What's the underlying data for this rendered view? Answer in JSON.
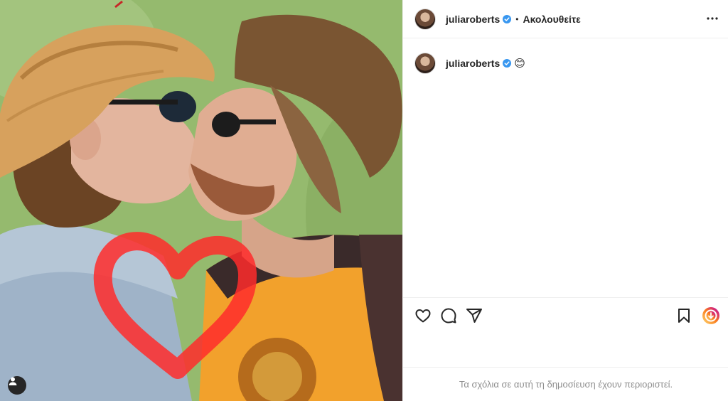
{
  "post": {
    "username": "juliaroberts",
    "follow_state": "Ακολουθείτε",
    "separator": "•",
    "caption_emoji": "😊",
    "comments_restricted": "Τα σχόλια σε αυτή τη δημοσίευση έχουν περιοριστεί."
  },
  "icons": {
    "verified": "verified-badge-icon",
    "more": "more-options-icon",
    "like": "heart-outline-icon",
    "comment": "comment-bubble-icon",
    "share": "paper-plane-icon",
    "save": "bookmark-icon",
    "tag": "user-tag-icon"
  },
  "colors": {
    "verified_blue": "#3897f0",
    "drawn_heart": "#ff2b2b",
    "muted_text": "#8e8e8e"
  }
}
